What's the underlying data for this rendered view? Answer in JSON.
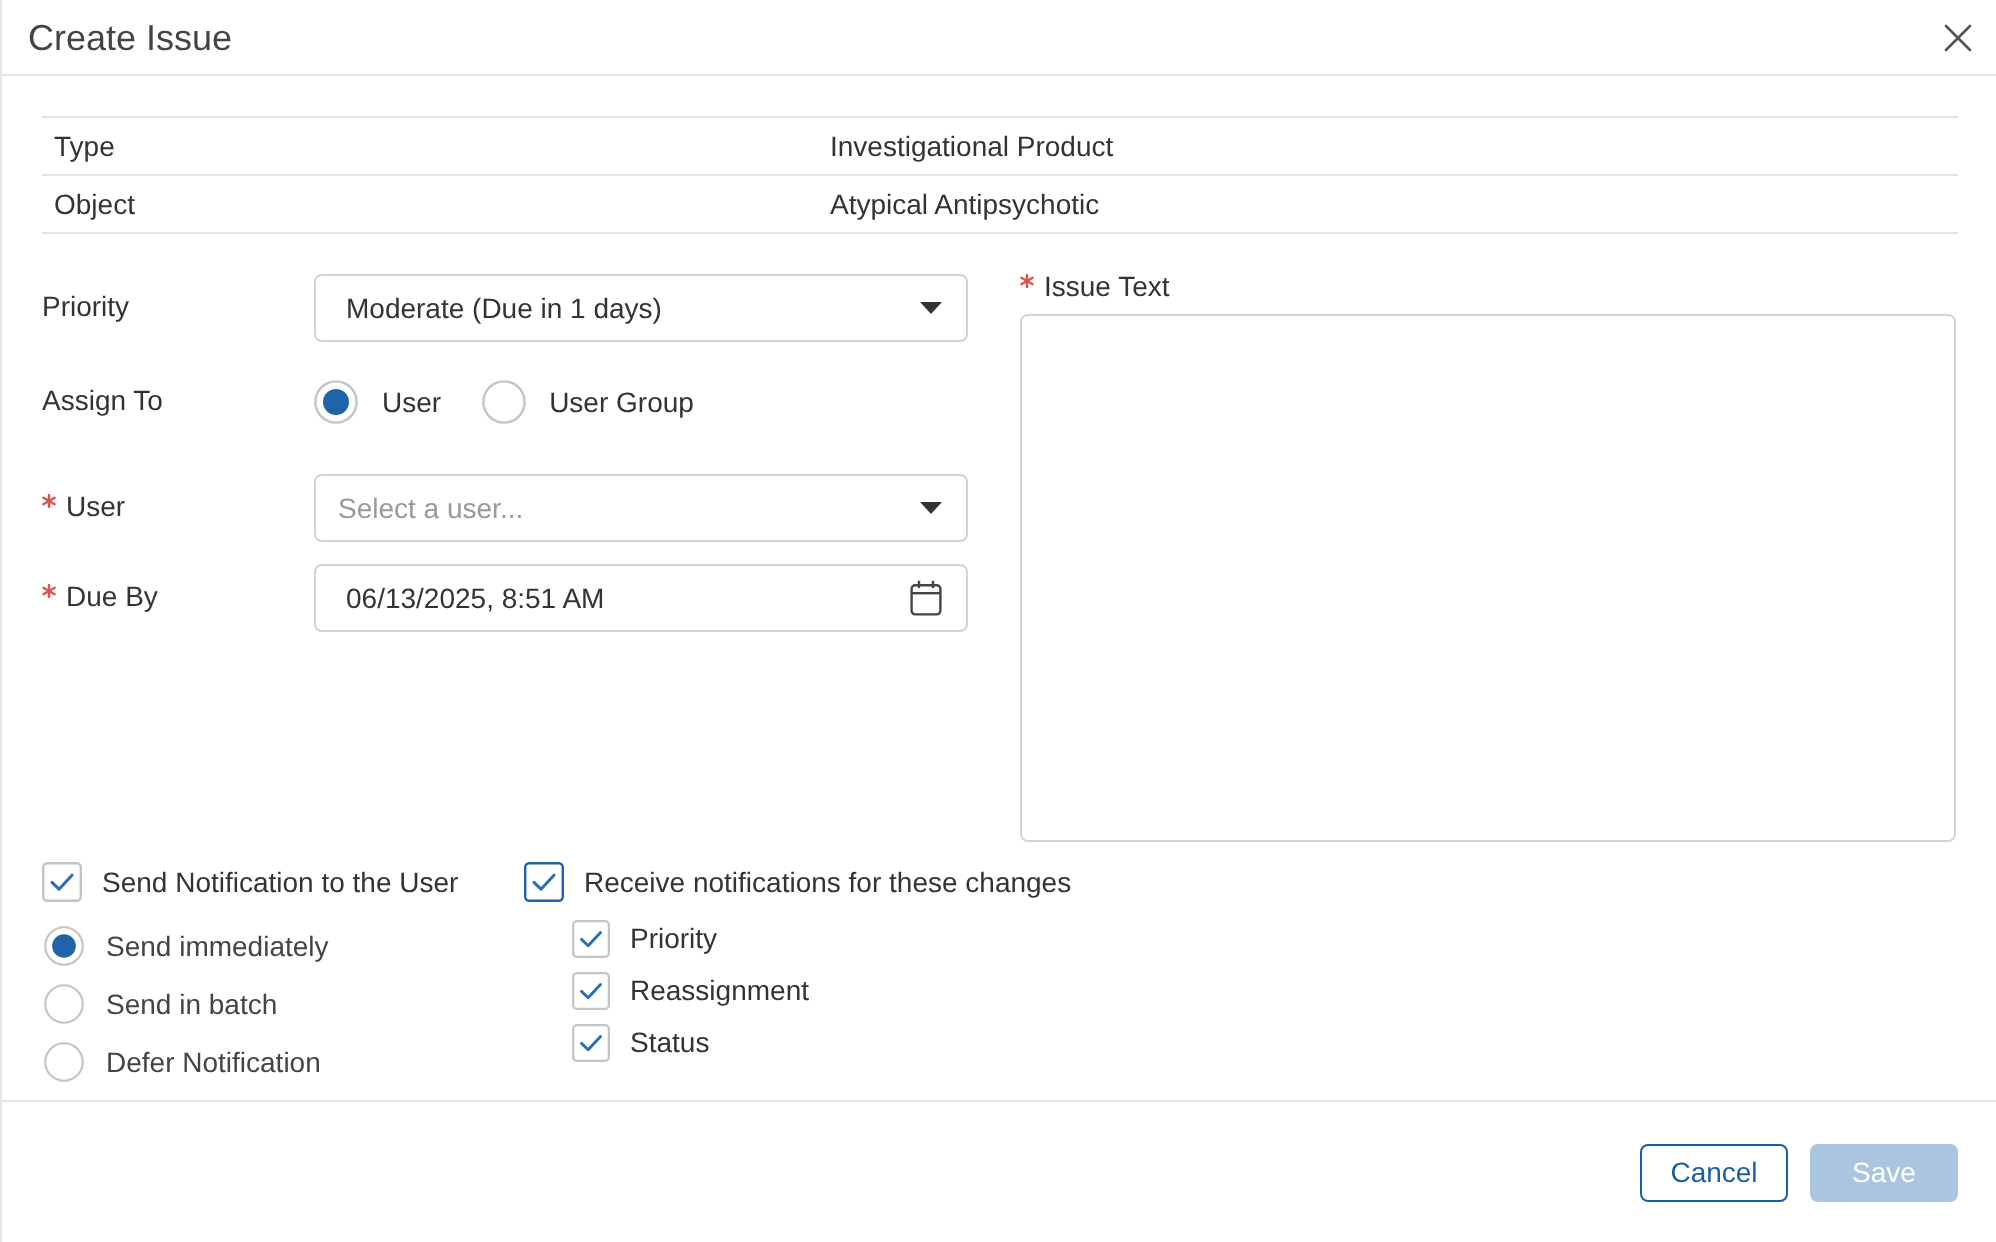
{
  "dialog": {
    "title": "Create Issue"
  },
  "info_table": {
    "rows": [
      {
        "label": "Type",
        "value": "Investigational Product"
      },
      {
        "label": "Object",
        "value": "Atypical Antipsychotic"
      }
    ]
  },
  "form": {
    "fields": [
      {
        "kind": "select",
        "label": "Priority",
        "required": false,
        "value": "Moderate (Due in 1 days)"
      },
      {
        "kind": "radio_group",
        "label": "Assign To",
        "required": false,
        "options": [
          {
            "label": "User",
            "selected": true
          },
          {
            "label": "User Group",
            "selected": false
          }
        ]
      },
      {
        "kind": "select",
        "label": "User",
        "required": true,
        "placeholder": "Select a user..."
      },
      {
        "kind": "datetime",
        "label": "Due By",
        "required": true,
        "value": "06/13/2025, 8:51 AM"
      }
    ],
    "issue_text": {
      "label": "Issue Text",
      "required": true
    }
  },
  "notifications": {
    "send": {
      "label": "Send Notification to the User",
      "checked": true,
      "focused": false
    },
    "delivery": [
      {
        "label": "Send immediately",
        "selected": true
      },
      {
        "label": "Send in batch",
        "selected": false
      },
      {
        "label": "Defer Notification",
        "selected": false
      }
    ],
    "receive": {
      "label": "Receive notifications for these changes",
      "checked": true,
      "focused": true
    },
    "changes": [
      {
        "label": "Priority",
        "checked": true
      },
      {
        "label": "Reassignment",
        "checked": true
      },
      {
        "label": "Status",
        "checked": true
      }
    ]
  },
  "buttons": [
    {
      "label": "Cancel",
      "kind": "secondary",
      "disabled": false
    },
    {
      "label": "Save",
      "kind": "primary",
      "disabled": true
    }
  ]
}
